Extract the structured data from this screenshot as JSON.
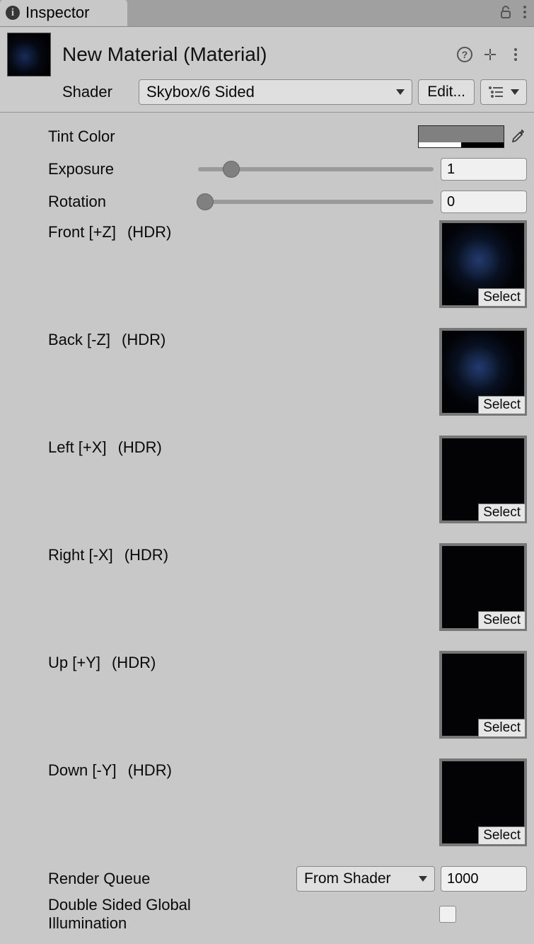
{
  "tab": {
    "label": "Inspector"
  },
  "header": {
    "title": "New Material (Material)",
    "shader_label": "Shader",
    "shader_value": "Skybox/6 Sided",
    "edit_button": "Edit..."
  },
  "props": {
    "tint": {
      "label": "Tint Color",
      "color": "#808080"
    },
    "exposure": {
      "label": "Exposure",
      "value": "1",
      "value_num": 1,
      "min": 0,
      "max": 8
    },
    "rotation": {
      "label": "Rotation",
      "value": "0",
      "value_num": 0,
      "min": 0,
      "max": 360
    }
  },
  "textures": [
    {
      "name": "Front [+Z]",
      "hdr": "(HDR)",
      "select": "Select",
      "nebula": true
    },
    {
      "name": "Back [-Z]",
      "hdr": "(HDR)",
      "select": "Select",
      "nebula": true
    },
    {
      "name": "Left [+X]",
      "hdr": "(HDR)",
      "select": "Select",
      "nebula": false
    },
    {
      "name": "Right [-X]",
      "hdr": "(HDR)",
      "select": "Select",
      "nebula": false
    },
    {
      "name": "Up [+Y]",
      "hdr": "(HDR)",
      "select": "Select",
      "nebula": false
    },
    {
      "name": "Down [-Y]",
      "hdr": "(HDR)",
      "select": "Select",
      "nebula": false
    }
  ],
  "render_queue": {
    "label": "Render Queue",
    "mode": "From Shader",
    "value": "1000"
  },
  "dsgi": {
    "label": "Double Sided Global Illumination",
    "checked": false
  }
}
